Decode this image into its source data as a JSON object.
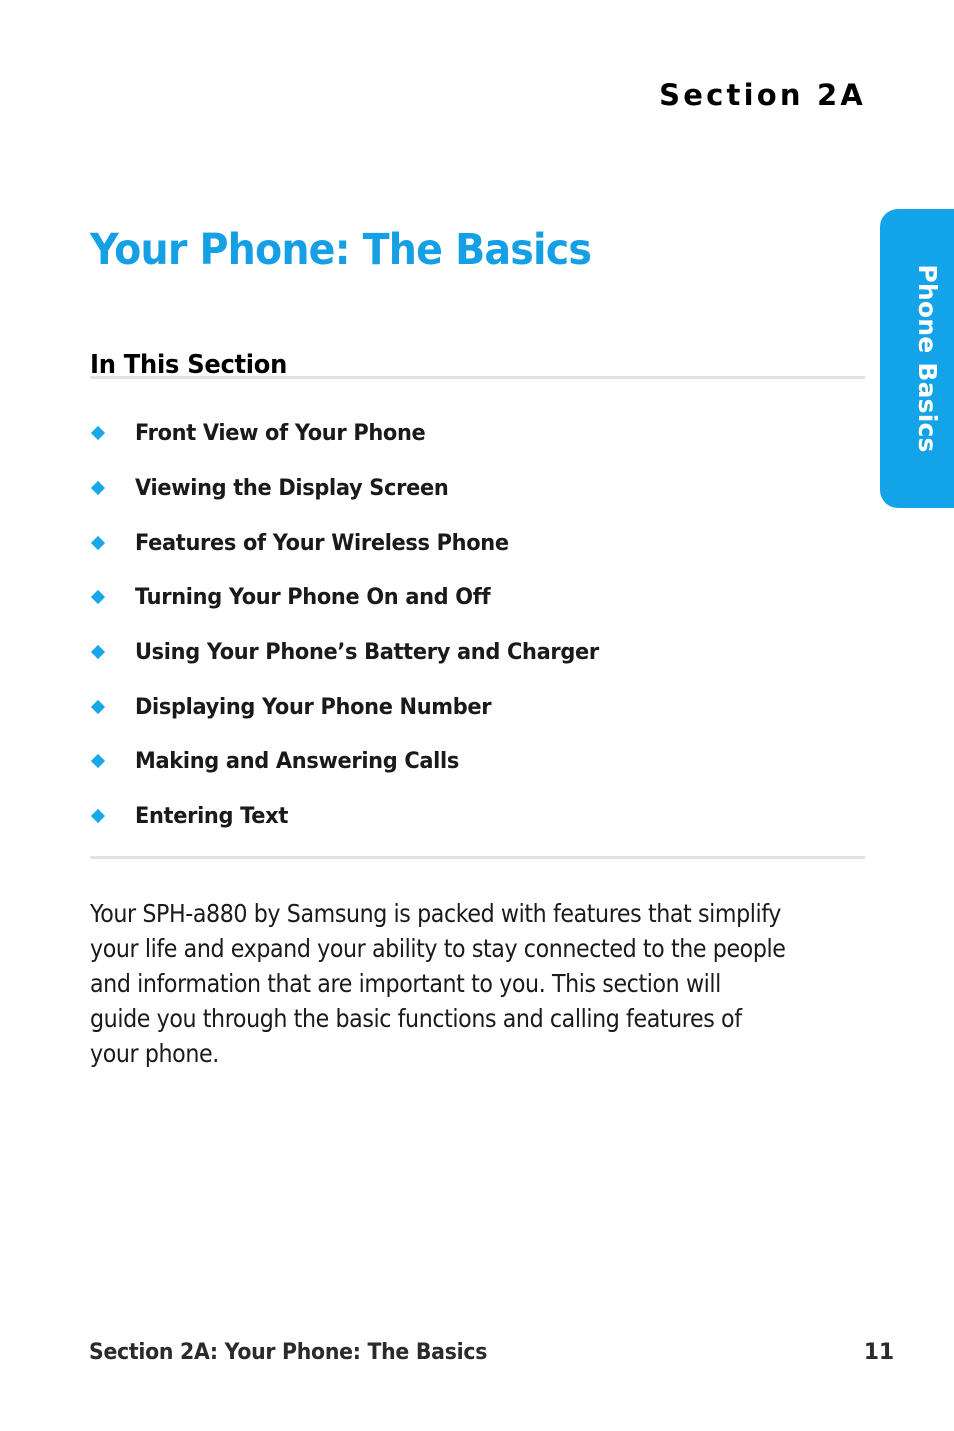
{
  "document": {
    "section_label": "Section 2A",
    "title": "Your Phone: The Basics",
    "subhead": "In This Section",
    "accent_color": "#12a3e8",
    "title_color": "#159fe5",
    "bullet_color": "#19a7e8",
    "rule_color": "#e2e2e2",
    "text_color": "#1a1a1a",
    "footer_color": "#2b2b2b"
  },
  "side_tab": {
    "label": "Phone Basics"
  },
  "toc": {
    "items": [
      {
        "label": "Front View of Your Phone",
        "bullet": "diamond-bullet-icon"
      },
      {
        "label": "Viewing the Display Screen",
        "bullet": "diamond-bullet-icon"
      },
      {
        "label": "Features of Your Wireless Phone",
        "bullet": "diamond-bullet-icon"
      },
      {
        "label": "Turning Your Phone On and Off",
        "bullet": "diamond-bullet-icon"
      },
      {
        "label": "Using Your Phone’s Battery and Charger",
        "bullet": "diamond-bullet-icon"
      },
      {
        "label": "Displaying Your Phone Number",
        "bullet": "diamond-bullet-icon"
      },
      {
        "label": "Making and Answering Calls",
        "bullet": "diamond-bullet-icon"
      },
      {
        "label": "Entering Text",
        "bullet": "diamond-bullet-icon"
      }
    ]
  },
  "body": {
    "paragraph": "Your SPH-a880 by Samsung is packed with features that simplify your life and expand your ability to stay connected to the people and information that are important to you. This section will guide you through the basic functions and calling features of your phone."
  },
  "footer": {
    "left": "Section 2A: Your Phone: The Basics",
    "page_number": "11"
  }
}
